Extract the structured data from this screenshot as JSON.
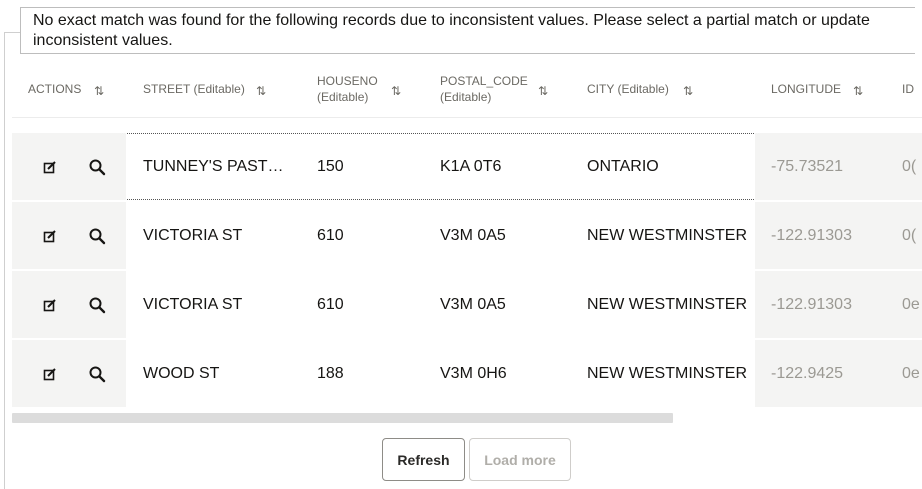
{
  "message": "No exact match was found for the following records due to inconsistent values. Please select a partial match or update inconsistent values.",
  "columns": [
    {
      "line1": "ACTIONS",
      "line2": ""
    },
    {
      "line1": "STREET (Editable)",
      "line2": ""
    },
    {
      "line1": "HOUSENO",
      "line2": "(Editable)"
    },
    {
      "line1": "POSTAL_CODE",
      "line2": "(Editable)"
    },
    {
      "line1": "CITY (Editable)",
      "line2": ""
    },
    {
      "line1": "LONGITUDE",
      "line2": ""
    },
    {
      "line1": "ID",
      "line2": ""
    }
  ],
  "sort_glyph": "⇅",
  "rows": [
    {
      "street": "TUNNEY'S PAST…",
      "houseno": "150",
      "postal_code": "K1A 0T6",
      "city": "ONTARIO",
      "longitude": "-75.73521",
      "id": "0("
    },
    {
      "street": "VICTORIA ST",
      "houseno": "610",
      "postal_code": "V3M 0A5",
      "city": "NEW WESTMINSTER",
      "longitude": "-122.91303",
      "id": "0("
    },
    {
      "street": "VICTORIA ST",
      "houseno": "610",
      "postal_code": "V3M 0A5",
      "city": "NEW WESTMINSTER",
      "longitude": "-122.91303",
      "id": "0e"
    },
    {
      "street": "WOOD ST",
      "houseno": "188",
      "postal_code": "V3M 0H6",
      "city": "NEW WESTMINSTER",
      "longitude": "-122.9425",
      "id": "0e"
    }
  ],
  "buttons": {
    "refresh": "Refresh",
    "load_more": "Load more"
  },
  "colors": {
    "text": "#161513",
    "muted": "#9b9993",
    "header": "#6b6963",
    "shaded": "#f4f4f3"
  }
}
